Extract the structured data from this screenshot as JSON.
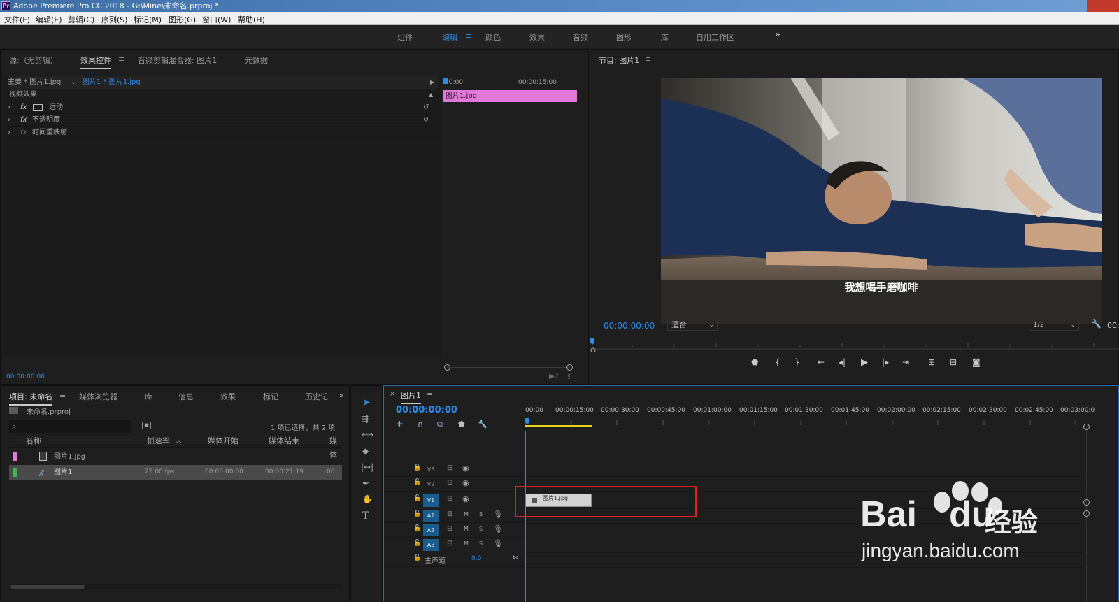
{
  "window": {
    "app_logo": "Pr",
    "title": "Adobe Premiere Pro CC 2018 - G:\\Mine\\未命名.prproj *"
  },
  "menu": [
    "文件(F)",
    "编辑(E)",
    "剪辑(C)",
    "序列(S)",
    "标记(M)",
    "图形(G)",
    "窗口(W)",
    "帮助(H)"
  ],
  "workspaces": {
    "items": [
      "组件",
      "编辑",
      "颜色",
      "效果",
      "音频",
      "图形",
      "库",
      "自用工作区"
    ],
    "active": "编辑",
    "overflow": "»"
  },
  "effect_panel": {
    "tabs": [
      "源:（无剪辑）",
      "效果控件",
      "音频剪辑混合器: 图片1",
      "元数据"
    ],
    "active_tab": "效果控件",
    "master_label": "主要 * 图片1.jpg",
    "clip_label": "图片1 * 图片1.jpg",
    "section": "视频效果",
    "effects": [
      "运动",
      "不透明度",
      "时间重映射"
    ],
    "fx_symbol": "fx",
    "ruler": [
      "00:00",
      "00:00:15:00"
    ],
    "clip_name": "图片1.jpg",
    "timecode": "00:00:00:00"
  },
  "program_monitor": {
    "title": "节目: 图片1",
    "subtitle": "我想喝手磨咖啡",
    "timecode": "00:00:00:00",
    "fit": "适合",
    "resolution": "1/2",
    "right_tc": "00:"
  },
  "project_panel": {
    "tabs": [
      "项目: 未命名",
      "媒体浏览器",
      "库",
      "信息",
      "效果",
      "标记",
      "历史记"
    ],
    "overflow": "»",
    "project_file": "未命名.prproj",
    "selection_info": "1 项已选择，共 2 项",
    "columns": [
      "名称",
      "帧速率",
      "媒体开始",
      "媒体结束",
      "媒体"
    ],
    "items": [
      {
        "name": "图片1.jpg",
        "color": "#e07ad6",
        "fps": "",
        "start": "",
        "end": "",
        "extra": ""
      },
      {
        "name": "图片1",
        "color": "#3fb34f",
        "fps": "25.00 fps",
        "start": "00:00:00:00",
        "end": "00:00:21:19",
        "extra": "00:"
      }
    ]
  },
  "tools": [
    "selection-tool",
    "track-select-tool",
    "ripple-edit-tool",
    "razor-tool",
    "slip-tool",
    "pen-tool",
    "hand-tool",
    "type-tool"
  ],
  "timeline": {
    "tab": "图片1",
    "timecode": "00:00:00:00",
    "ruler": [
      "00:00",
      "00:00:15:00",
      "00:00:30:00",
      "00:00:45:00",
      "00:01:00:00",
      "00:01:15:00",
      "00:01:30:00",
      "00:01:45:00",
      "00:02:00:00",
      "00:02:15:00",
      "00:02:30:00",
      "00:02:45:00",
      "00:03:00:0"
    ],
    "video_tracks": [
      "V3",
      "V2",
      "V1"
    ],
    "audio_tracks": [
      "A1",
      "A2",
      "A3"
    ],
    "audio_buttons": [
      "M",
      "S"
    ],
    "master": "主声道",
    "master_value": "0.0",
    "clip_name": "图片1.jpg"
  },
  "watermark": {
    "brand": "Bai",
    "brand2": "du",
    "chinese": "经验",
    "url": "jingyan.baidu.com"
  },
  "colors": {
    "accent": "#2d8ceb",
    "clip_pink": "#e07ad6",
    "highlight_red": "#e02020"
  }
}
